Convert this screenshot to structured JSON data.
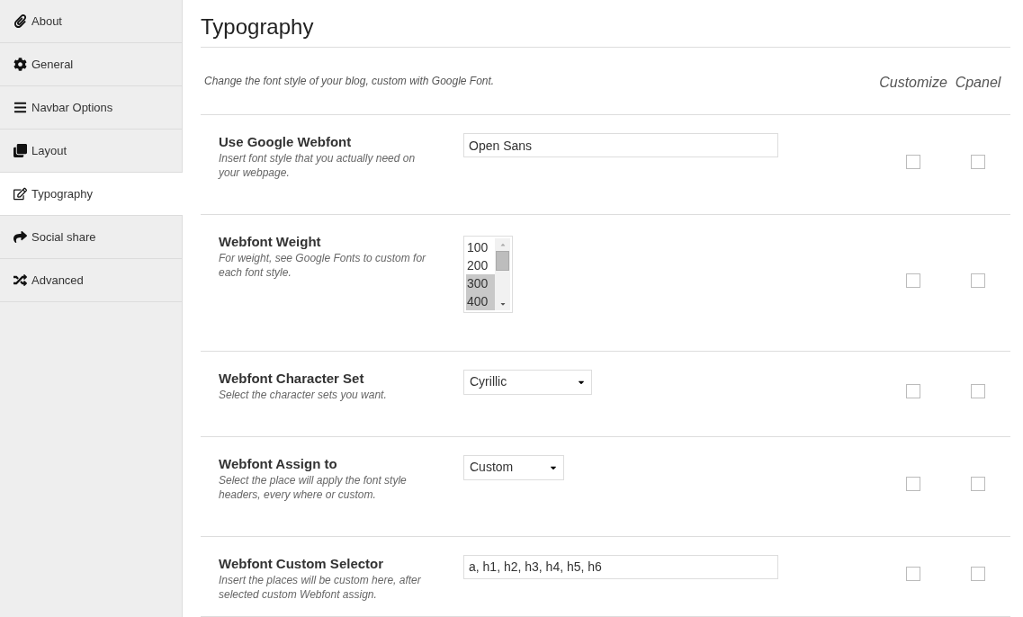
{
  "sidebar": {
    "items": [
      {
        "label": "About",
        "kind": "paperclip",
        "selected": false
      },
      {
        "label": "General",
        "kind": "gear",
        "selected": false
      },
      {
        "label": "Navbar Options",
        "kind": "bars",
        "selected": false
      },
      {
        "label": "Layout",
        "kind": "clone",
        "selected": false
      },
      {
        "label": "Typography",
        "kind": "edit",
        "selected": true
      },
      {
        "label": "Social share",
        "kind": "share",
        "selected": false
      },
      {
        "label": "Advanced",
        "kind": "shuffle",
        "selected": false
      }
    ]
  },
  "page": {
    "title": "Typography",
    "description": "Change the font style of your blog, custom with Google Font.",
    "columns": [
      "Customize",
      "Cpanel"
    ]
  },
  "settings": [
    {
      "kind": "text",
      "label": "Use Google Webfont",
      "help": "Insert font style that you actually need on your webpage.",
      "value": "Open Sans",
      "customize": false,
      "cpanel": false
    },
    {
      "kind": "listbox",
      "label": "Webfont Weight",
      "help": "For weight, see Google Fonts to custom for each font style.",
      "options": [
        {
          "label": "100",
          "selected": false
        },
        {
          "label": "200",
          "selected": false
        },
        {
          "label": "300",
          "selected": true
        },
        {
          "label": "400",
          "selected": true
        }
      ],
      "customize": false,
      "cpanel": false
    },
    {
      "kind": "select",
      "label": "Webfont Character Set",
      "help": "Select the character sets you want.",
      "value": "Cyrillic",
      "customize": false,
      "cpanel": false
    },
    {
      "kind": "select",
      "label": "Webfont Assign to",
      "help": "Select the place will apply the font style headers, every where or custom.",
      "value": "Custom",
      "customize": false,
      "cpanel": false
    },
    {
      "kind": "text",
      "label": "Webfont Custom Selector",
      "help": "Insert the places will be custom here, after selected custom Webfont assign.",
      "value": "a, h1, h2, h3, h4, h5, h6",
      "customize": false,
      "cpanel": false
    }
  ]
}
